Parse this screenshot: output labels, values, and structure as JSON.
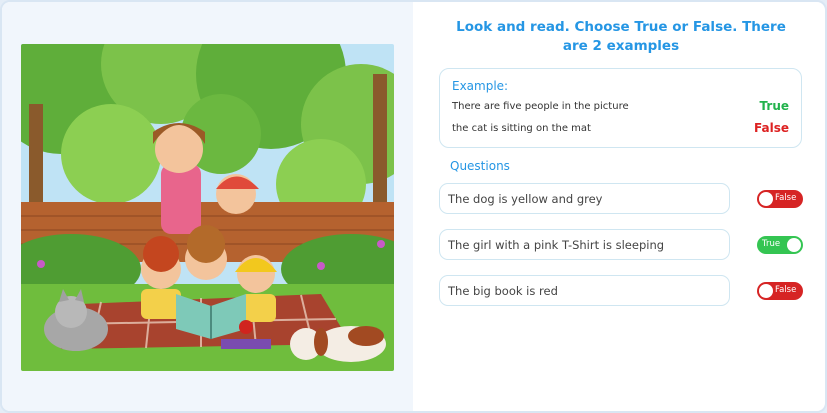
{
  "title": "Look and read. Choose True or False. There are 2 examples",
  "example": {
    "heading": "Example:",
    "rows": [
      {
        "text": "There are five people in the picture",
        "answer": "True"
      },
      {
        "text": "the cat is sitting on the mat",
        "answer": "False"
      }
    ]
  },
  "questions": {
    "heading": "Questions",
    "items": [
      {
        "text": "The dog is yellow and grey",
        "toggle_label": "False",
        "state": "off"
      },
      {
        "text": "The girl with a pink T-Shirt is sleeping",
        "toggle_label": "True",
        "state": "on"
      },
      {
        "text": "The big book is red",
        "toggle_label": "False",
        "state": "off"
      }
    ]
  },
  "colors": {
    "accent": "#2596e4",
    "true": "#22b24c",
    "false": "#dd2222",
    "toggle_on": "#34c552",
    "toggle_off": "#d62424"
  }
}
